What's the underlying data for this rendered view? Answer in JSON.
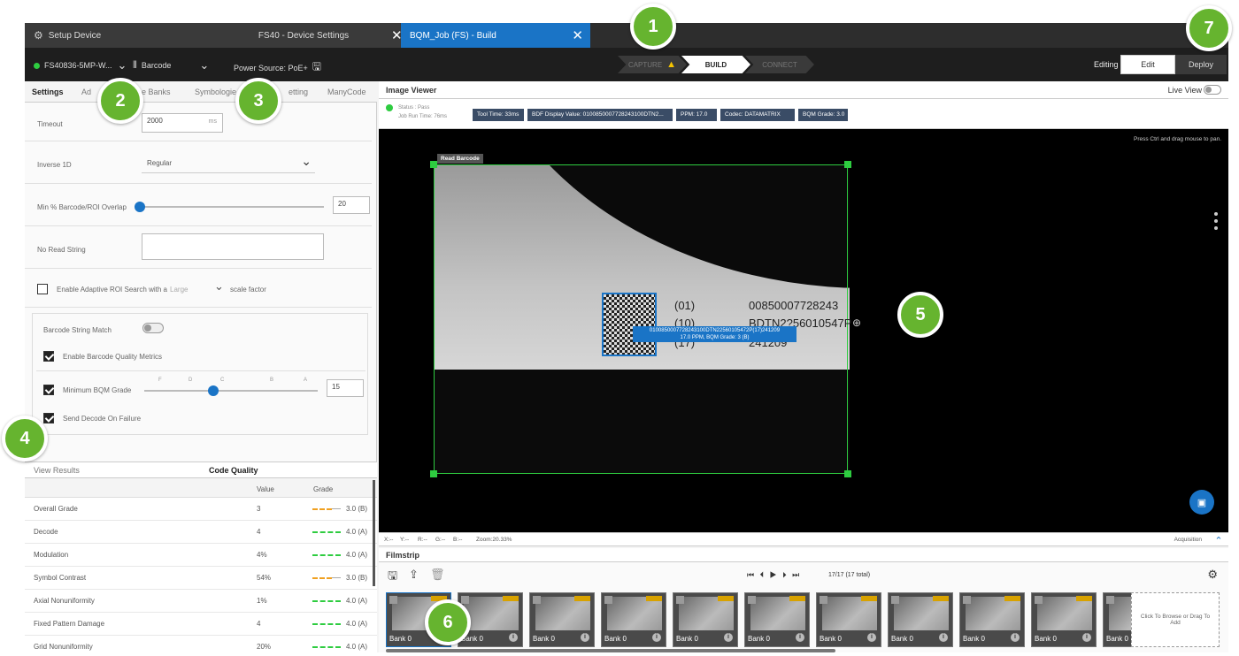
{
  "tabs": [
    {
      "label": "Setup Device"
    },
    {
      "label": "FS40 - Device Settings"
    },
    {
      "label": "BQM_Job (FS) - Build"
    }
  ],
  "toolbar": {
    "device_name": "FS40836-5MP-W...",
    "tool_label": "Barcode",
    "power_source": "Power Source: PoE+",
    "steps": [
      "CAPTURE",
      "BUILD",
      "CONNECT"
    ],
    "active_step": "BUILD",
    "editing_label": "Editing",
    "edit_button": "Edit",
    "deploy_button": "Deploy"
  },
  "left_tabs": [
    "Settings",
    "Ad",
    "e Banks",
    "Symbologie",
    "etting",
    "ManyCode"
  ],
  "settings": {
    "timeout_label": "Timeout",
    "timeout_value": "2000",
    "timeout_unit": "ms",
    "inverse_label": "Inverse 1D",
    "inverse_value": "Regular",
    "overlap_label": "Min % Barcode/ROI Overlap",
    "overlap_value": "20",
    "overlap_fraction": 0.0,
    "noread_label": "No Read String",
    "noread_value": "",
    "adaptive_label": "Enable Adaptive ROI Search with a",
    "adaptive_size": "Large",
    "adaptive_suffix": "scale factor",
    "adaptive_checked": false,
    "match_label": "Barcode String Match",
    "match_on": false,
    "bqm_enable_label": "Enable Barcode Quality Metrics",
    "bqm_enable_checked": true,
    "min_bqm_label": "Minimum BQM Grade",
    "min_bqm_checked": true,
    "min_bqm_ticks": [
      "F",
      "D",
      "C",
      "B",
      "A"
    ],
    "min_bqm_value": "15",
    "min_bqm_fraction": 0.4,
    "send_decode_label": "Send Decode On Failure",
    "send_decode_checked": true
  },
  "results": {
    "tabs": [
      "View Results",
      "Code Quality"
    ],
    "headers": [
      "Value",
      "Grade"
    ],
    "rows": [
      {
        "name": "Overall Grade",
        "value": "3",
        "grade": "3.0 (B)",
        "color": "#f0a020"
      },
      {
        "name": "Decode",
        "value": "4",
        "grade": "4.0 (A)",
        "color": "#2ecc40"
      },
      {
        "name": "Modulation",
        "value": "4%",
        "grade": "4.0 (A)",
        "color": "#2ecc40"
      },
      {
        "name": "Symbol Contrast",
        "value": "54%",
        "grade": "3.0 (B)",
        "color": "#f0a020"
      },
      {
        "name": "Axial Nonuniformity",
        "value": "1%",
        "grade": "4.0 (A)",
        "color": "#2ecc40"
      },
      {
        "name": "Fixed Pattern Damage",
        "value": "4",
        "grade": "4.0 (A)",
        "color": "#2ecc40"
      },
      {
        "name": "Grid Nonuniformity",
        "value": "20%",
        "grade": "4.0 (A)",
        "color": "#2ecc40"
      }
    ]
  },
  "image_viewer": {
    "title": "Image Viewer",
    "live_view": "Live View",
    "status_label": "Status : Pass",
    "job_run_time": "Job Run Time: 76ms",
    "chips": [
      "Tool Time: 33ms",
      "BDF Display Value: 0100850007728243100DTN2...",
      "PPM: 17.0",
      "Codec: DATAMATRIX",
      "BQM Grade: 3.0"
    ],
    "pan_hint": "Press Ctrl and drag mouse to pan.",
    "roi_label": "Read Barcode",
    "barcode_lines": [
      "(01)",
      "00850007728243",
      "(10)",
      "BDTN2?56010547P",
      "(17)",
      "241209"
    ],
    "decode_line1": "0100850007728243100DTN22560105472P(17)241209",
    "decode_line2": "17.0 PPM, BQM Grade: 3 (B)"
  },
  "coord_bar": {
    "x": "X:--",
    "y": "Y:--",
    "r": "R:--",
    "g": "G:--",
    "b": "B:--",
    "zoom": "Zoom:20.33%",
    "acquisition": "Acquisition"
  },
  "filmstrip": {
    "title": "Filmstrip",
    "counter": "17/17 (17 total)",
    "thumbs": [
      "Bank 0",
      "Bank 0",
      "Bank 0",
      "Bank 0",
      "Bank 0",
      "Bank 0",
      "Bank 0",
      "Bank 0",
      "Bank 0",
      "Bank 0",
      "Bank 0"
    ],
    "dropzone": "Click To Browse or Drag To Add"
  },
  "callouts": [
    "1",
    "2",
    "3",
    "4",
    "5",
    "6",
    "7"
  ],
  "colors": {
    "accent": "#1a74c6",
    "callout": "#66b42f",
    "roi": "#2ecc40",
    "warning": "#f5c400"
  }
}
